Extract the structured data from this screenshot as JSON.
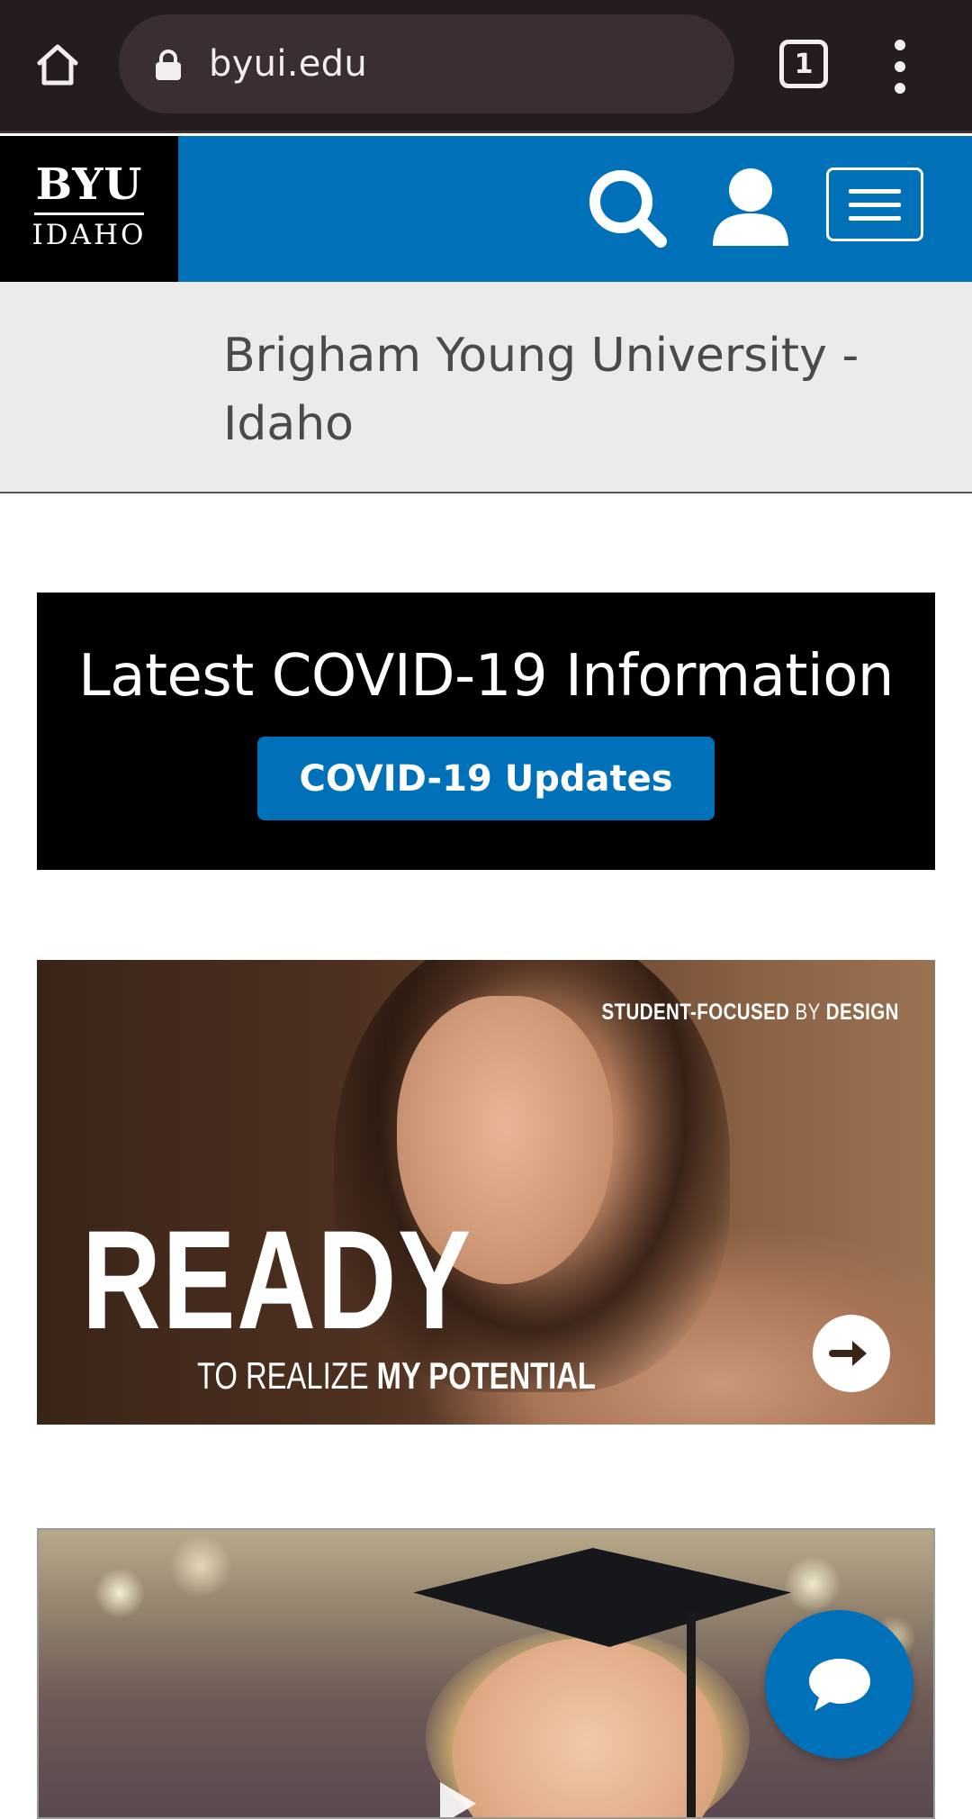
{
  "browser": {
    "url": "byui.edu",
    "tab_count": "1",
    "icons": {
      "home": "home-icon",
      "lock": "lock-icon",
      "tabs": "tab-switcher-icon",
      "menu": "more-vert-icon"
    }
  },
  "header": {
    "logo_line1": "BYU",
    "logo_line2": "IDAHO",
    "icons": {
      "search": "search-icon",
      "account": "user-icon",
      "menu": "hamburger-menu-icon"
    },
    "brand_color": "#0071b9"
  },
  "page_title": "Brigham Young University - Idaho",
  "covid": {
    "heading": "Latest COVID-19 Information",
    "button_label": "COVID-19 Updates"
  },
  "hero": {
    "tagline_bold": "STUDENT-FOCUSED",
    "tagline_light": "BY",
    "tagline_end": "DESIGN",
    "headline": "READY",
    "sub_light": "TO REALIZE",
    "sub_bold": "MY POTENTIAL",
    "arrow_icon": "arrow-right-icon"
  },
  "chat": {
    "icon": "chat-bubble-icon"
  }
}
